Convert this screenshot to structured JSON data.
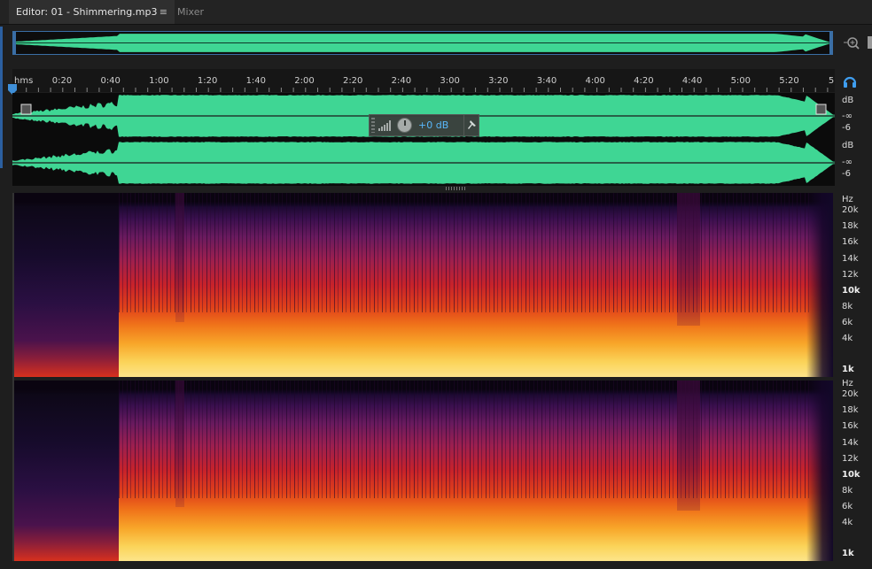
{
  "tabs": {
    "editor_label": "Editor: 01 - Shimmering.mp3",
    "editor_menu_icon": "≡",
    "mixer_label": "Mixer"
  },
  "icons": {
    "zoom": "zoom-selection-icon",
    "headphones": "headphones-icon",
    "pin": "pin-icon",
    "playhead": "playhead-icon"
  },
  "ruler": {
    "unit_label": "hms",
    "ticks": [
      "0:20",
      "0:40",
      "1:00",
      "1:20",
      "1:40",
      "2:00",
      "2:20",
      "2:40",
      "3:00",
      "3:20",
      "3:40",
      "4:00",
      "4:20",
      "4:40",
      "5:00",
      "5:20",
      "5"
    ]
  },
  "amplitude_scale": {
    "channel1": {
      "unit": "dB",
      "inf": "-∞",
      "minus6": "-6"
    },
    "channel2": {
      "unit": "dB",
      "inf": "-∞",
      "minus6": "-6"
    }
  },
  "hud": {
    "gain_value": "+0 dB"
  },
  "frequency_scale": {
    "unit": "Hz",
    "labels": [
      "20k",
      "18k",
      "16k",
      "14k",
      "12k",
      "10k",
      "8k",
      "6k",
      "4k",
      "1k"
    ],
    "bold_labels": [
      "10k",
      "1k"
    ]
  },
  "colors": {
    "waveform": "#3fd694",
    "accent_blue": "#3a6ea5",
    "hud_value": "#5bb7ff"
  }
}
